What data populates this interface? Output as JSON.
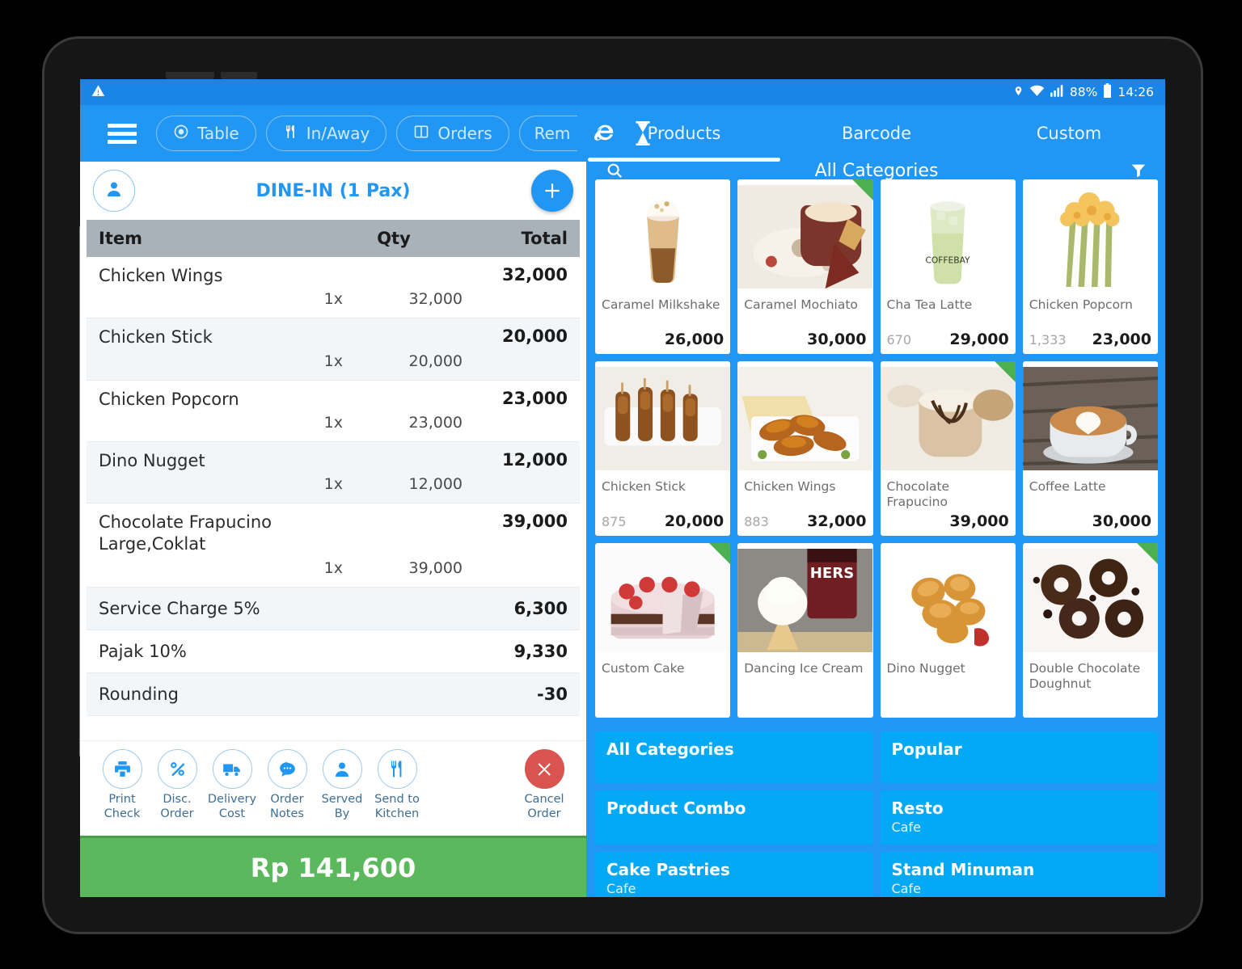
{
  "status_bar": {
    "battery_percent": "88%",
    "time": "14:26",
    "icons": [
      "location-pin-icon",
      "wifi-icon",
      "signal-bars-icon",
      "battery-icon"
    ]
  },
  "app_bar": {
    "menu_icon": "hamburger-menu-icon",
    "pills": [
      {
        "label": "Table",
        "icon": "target-icon"
      },
      {
        "label": "In/Away",
        "icon": "cutlery-icon"
      },
      {
        "label": "Orders",
        "icon": "columns-icon"
      },
      {
        "label": "Rem",
        "icon": ""
      }
    ],
    "icons": [
      "internet-explorer-icon",
      "hourglass-icon"
    ],
    "tabs": [
      {
        "label": "Products",
        "active": true
      },
      {
        "label": "Barcode",
        "active": false
      },
      {
        "label": "Custom",
        "active": false
      }
    ]
  },
  "order": {
    "title": "DINE-IN (1 Pax)",
    "customer_icon": "person-icon",
    "add_label": "+",
    "columns": {
      "item": "Item",
      "qty": "Qty",
      "total": "Total"
    },
    "items": [
      {
        "name": "Chicken Wings",
        "qty": "1x",
        "price": "32,000",
        "total": "32,000"
      },
      {
        "name": "Chicken Stick",
        "qty": "1x",
        "price": "20,000",
        "total": "20,000"
      },
      {
        "name": "Chicken Popcorn",
        "qty": "1x",
        "price": "23,000",
        "total": "23,000"
      },
      {
        "name": "Dino Nugget",
        "qty": "1x",
        "price": "12,000",
        "total": "12,000"
      },
      {
        "name": "Chocolate Frapucino\nLarge,Coklat",
        "qty": "1x",
        "price": "39,000",
        "total": "39,000"
      }
    ],
    "charges": [
      {
        "label": "Service Charge 5%",
        "value": "6,300"
      },
      {
        "label": "Pajak 10%",
        "value": "9,330"
      },
      {
        "label": "Rounding",
        "value": "-30"
      }
    ],
    "actions": [
      {
        "label": "Print\nCheck",
        "icon": "printer-icon"
      },
      {
        "label": "Disc.\nOrder",
        "icon": "percent-icon"
      },
      {
        "label": "Delivery\nCost",
        "icon": "truck-icon"
      },
      {
        "label": "Order\nNotes",
        "icon": "chat-bubble-icon"
      },
      {
        "label": "Served\nBy",
        "icon": "person-icon"
      },
      {
        "label": "Send to\nKitchen",
        "icon": "cutlery-icon"
      }
    ],
    "cancel": {
      "label": "Cancel\nOrder",
      "icon": "close-x-icon"
    },
    "grand_total": "Rp 141,600"
  },
  "products": {
    "search_icon": "search-icon",
    "category_title": "All Categories",
    "filter_icon": "funnel-filter-icon",
    "items": [
      {
        "name": "Caramel Milkshake",
        "code": "",
        "price": "26,000",
        "flag": false,
        "art": "milkshake"
      },
      {
        "name": "Caramel Mochiato",
        "code": "",
        "price": "30,000",
        "flag": true,
        "art": "mochiato"
      },
      {
        "name": "Cha Tea Latte",
        "code": "670",
        "price": "29,000",
        "flag": false,
        "art": "greentea"
      },
      {
        "name": "Chicken Popcorn",
        "code": "1,333",
        "price": "23,000",
        "flag": false,
        "art": "popcorn"
      },
      {
        "name": "Chicken Stick",
        "code": "875",
        "price": "20,000",
        "flag": false,
        "art": "skewer"
      },
      {
        "name": "Chicken Wings",
        "code": "883",
        "price": "32,000",
        "flag": false,
        "art": "wings"
      },
      {
        "name": "Chocolate Frapucino",
        "code": "",
        "price": "39,000",
        "flag": true,
        "art": "frapucino"
      },
      {
        "name": "Coffee Latte",
        "code": "",
        "price": "30,000",
        "flag": false,
        "art": "latte"
      },
      {
        "name": "Custom Cake",
        "code": "",
        "price": "",
        "flag": true,
        "art": "cake"
      },
      {
        "name": "Dancing Ice Cream",
        "code": "",
        "price": "",
        "flag": false,
        "art": "icecream"
      },
      {
        "name": "Dino Nugget",
        "code": "",
        "price": "",
        "flag": false,
        "art": "nugget"
      },
      {
        "name": "Double Chocolate Doughnut",
        "code": "",
        "price": "",
        "flag": true,
        "art": "doughnut"
      }
    ]
  },
  "categories": [
    {
      "name": "All Categories",
      "sub": ""
    },
    {
      "name": "Popular",
      "sub": ""
    },
    {
      "name": "Product Combo",
      "sub": ""
    },
    {
      "name": "Resto",
      "sub": "Cafe"
    },
    {
      "name": "Cake Pastries",
      "sub": "Cafe"
    },
    {
      "name": "Stand Minuman",
      "sub": "Cafe"
    }
  ],
  "colors": {
    "primary_blue": "#2196f3",
    "status_blue": "#1b84e7",
    "category_blue": "#03a9f4",
    "total_green": "#5cb85c",
    "flag_green": "#4caf50",
    "cancel_red": "#d9534f",
    "header_gray": "#a9b1b9"
  }
}
